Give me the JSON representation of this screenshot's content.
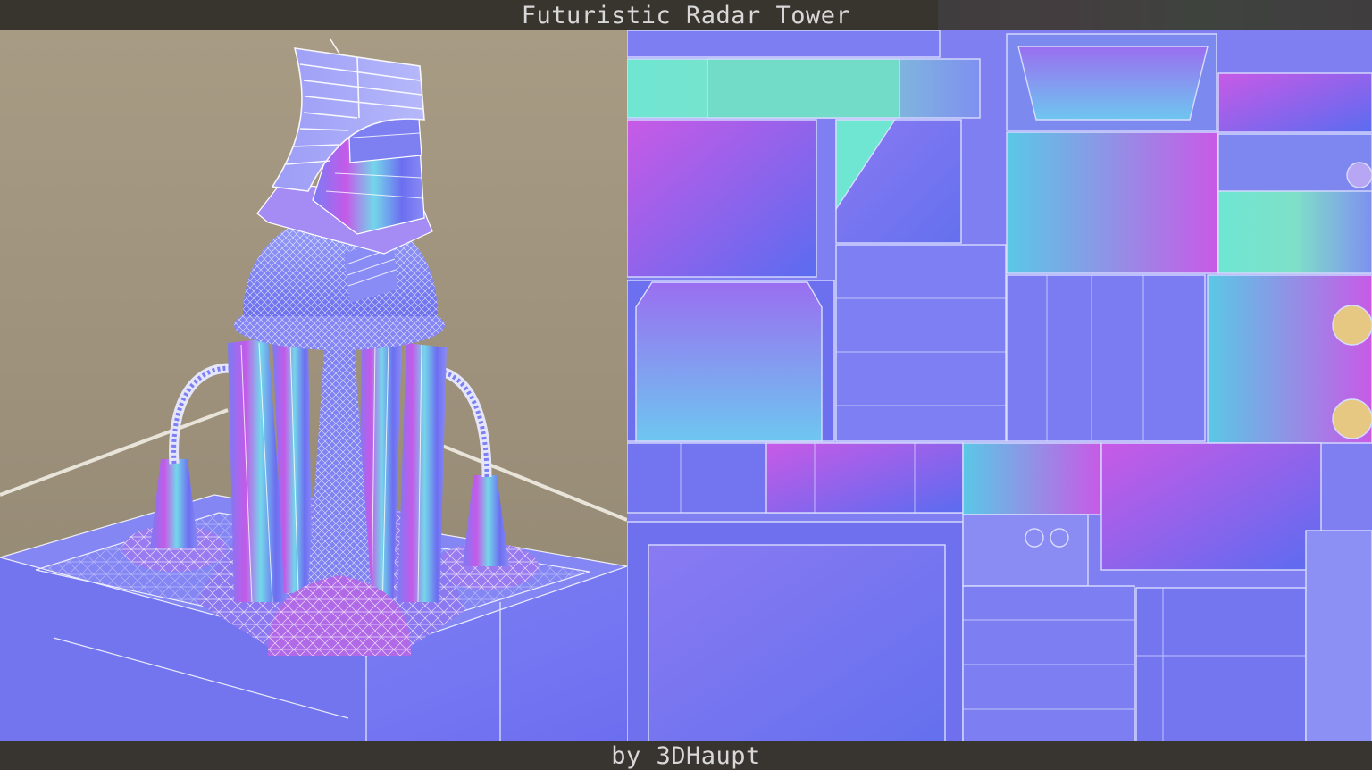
{
  "title": "Futuristic Radar Tower",
  "credit": "by 3DHaupt",
  "viewport": {
    "background_color": "#a89b84",
    "model_base_color": "#7f7ff2",
    "wireframe_color": "#ffffff"
  },
  "texture_sheet": {
    "base_color": "#7f7ff2",
    "accent_colors": [
      "#c85ae6",
      "#6ee6d2",
      "#5a6cf0",
      "#e6c882"
    ]
  }
}
